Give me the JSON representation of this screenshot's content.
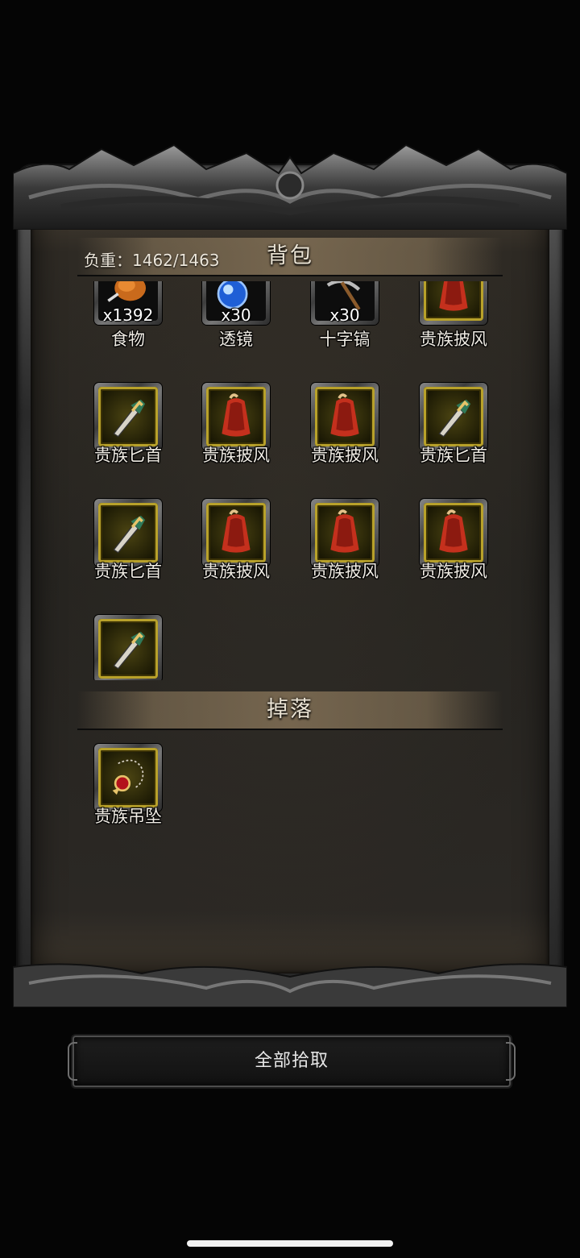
{
  "bag": {
    "weight_label": "负重：1462/1463",
    "title": "背包",
    "items": [
      {
        "name": "食物",
        "qty": "x1392",
        "icon": "roast-meat-icon",
        "rarity": "normal"
      },
      {
        "name": "透镜",
        "qty": "x30",
        "icon": "blue-lens-icon",
        "rarity": "normal"
      },
      {
        "name": "十字镐",
        "qty": "x30",
        "icon": "pickaxe-icon",
        "rarity": "normal"
      },
      {
        "name": "贵族披风",
        "qty": "",
        "icon": "red-cloak-icon",
        "rarity": "gold"
      },
      {
        "name": "贵族匕首",
        "qty": "",
        "icon": "dagger-icon",
        "rarity": "gold"
      },
      {
        "name": "贵族披风",
        "qty": "",
        "icon": "red-cloak-icon",
        "rarity": "gold"
      },
      {
        "name": "贵族披风",
        "qty": "",
        "icon": "red-cloak-icon",
        "rarity": "gold"
      },
      {
        "name": "贵族匕首",
        "qty": "",
        "icon": "dagger-icon",
        "rarity": "gold"
      },
      {
        "name": "贵族匕首",
        "qty": "",
        "icon": "dagger-icon",
        "rarity": "gold"
      },
      {
        "name": "贵族披风",
        "qty": "",
        "icon": "red-cloak-icon",
        "rarity": "gold"
      },
      {
        "name": "贵族披风",
        "qty": "",
        "icon": "red-cloak-icon",
        "rarity": "gold"
      },
      {
        "name": "贵族披风",
        "qty": "",
        "icon": "red-cloak-icon",
        "rarity": "gold"
      },
      {
        "name": "",
        "qty": "",
        "icon": "dagger-icon",
        "rarity": "gold"
      }
    ]
  },
  "drop": {
    "title": "掉落",
    "items": [
      {
        "name": "贵族吊坠",
        "qty": "",
        "icon": "pendant-icon",
        "rarity": "gold"
      }
    ]
  },
  "pickup_all_label": "全部拾取",
  "colors": {
    "gold_border": "#b8a12a",
    "parchment": "#262420",
    "text": "#f0ece4"
  }
}
